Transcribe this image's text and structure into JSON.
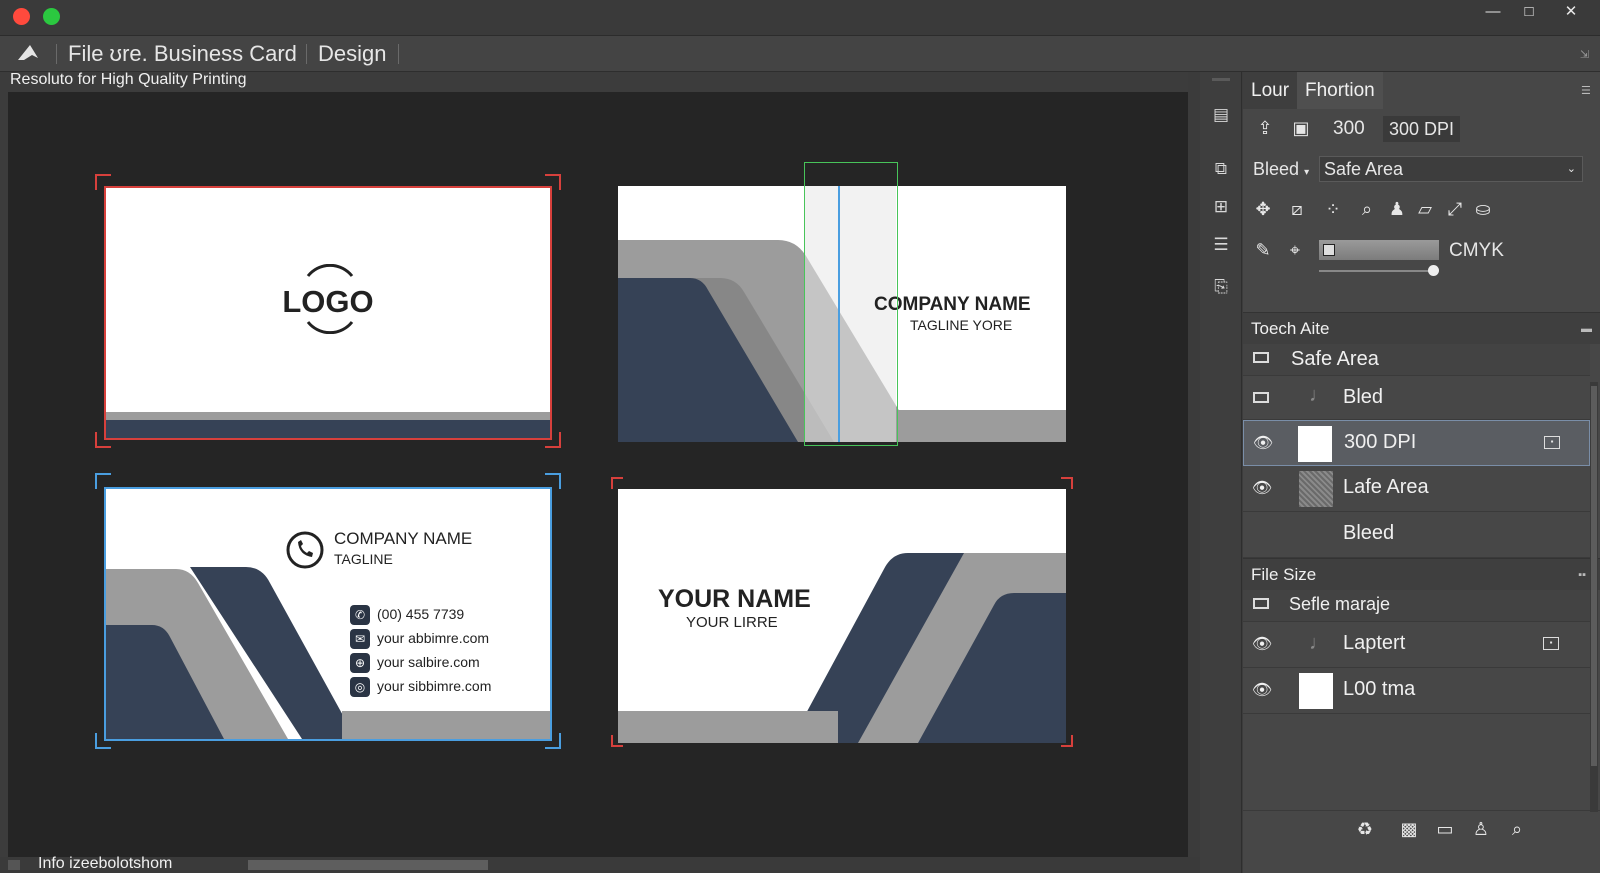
{
  "window": {
    "title": "File ʊre. Business Card",
    "close_color": "#ff4a3d",
    "maximize_color": "#2bc840",
    "controls": {
      "minimize": "—",
      "maximize": "□",
      "close": "✕"
    }
  },
  "menubar": {
    "app_icon": "arrow-logo-icon",
    "title": "File ʊre. Business Card",
    "design": "Design"
  },
  "subtitle": "Resoluto for High Quality Printing",
  "cards": {
    "card1": {
      "logo": "LOGO"
    },
    "card2": {
      "company": "COMPANY NAME",
      "tagline": "TAGLINE YORE"
    },
    "card3": {
      "company": "COMPANY NAME",
      "tagline": "TAGLINE",
      "phone": "(00) 455 7739",
      "email": "your abbimre.com",
      "web": "your salbire.com",
      "social": "your sibbimre.com"
    },
    "card4": {
      "name": "YOUR NAME",
      "title": "YOUR LIRRE"
    }
  },
  "colors": {
    "navy": "#364256",
    "gray": "#9c9c9c",
    "red_crop": "#d7403c",
    "blue_crop": "#4a9ee0",
    "green_guide": "#48c45a"
  },
  "panel": {
    "tabs": [
      "Lour",
      "Fhortion"
    ],
    "resolution_value": "300",
    "resolution_dpi": "300 DPI",
    "bleed_label": "Bleed",
    "safe_area_select": "Safe Area",
    "color_mode": "CMYK",
    "slider_value": 0.96,
    "section1_title": "Toech Aite",
    "layers1": [
      {
        "name": "Safe Area",
        "visible": false
      },
      {
        "name": "Bled",
        "visible": false
      },
      {
        "name": "300 DPI",
        "visible": true
      },
      {
        "name": "Lafe Area",
        "visible": true
      },
      {
        "name": "Bleed",
        "visible": false
      }
    ],
    "section2_title": "File Size",
    "layers2": [
      {
        "name": "Sefle maraje",
        "visible": false
      },
      {
        "name": "Laptert",
        "visible": true
      },
      {
        "name": "L00 tma",
        "visible": true
      }
    ]
  },
  "status": {
    "text": "Info izeebolotshom"
  }
}
